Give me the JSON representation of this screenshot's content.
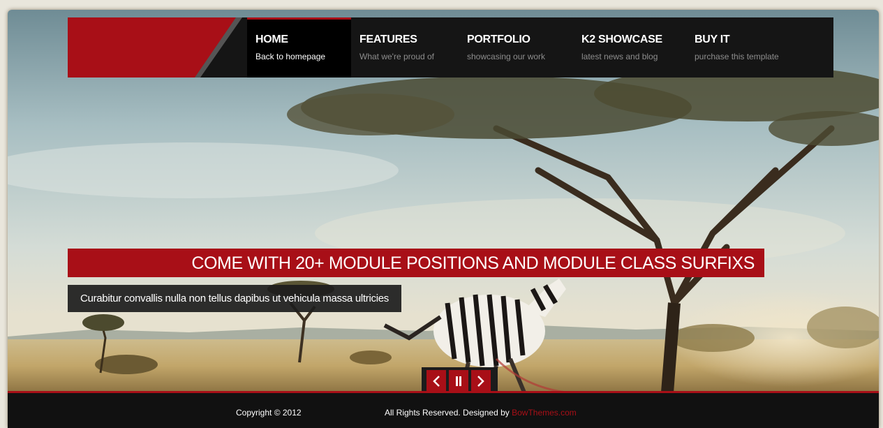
{
  "nav": [
    {
      "title": "HOME",
      "subtitle": "Back to homepage"
    },
    {
      "title": "FEATURES",
      "subtitle": "What we're proud of"
    },
    {
      "title": "PORTFOLIO",
      "subtitle": "showcasing our work"
    },
    {
      "title": "K2 SHOWCASE",
      "subtitle": "latest news and blog"
    },
    {
      "title": "BUY IT",
      "subtitle": "purchase this template"
    }
  ],
  "slide": {
    "title": "COME WITH 20+ MODULE POSITIONS AND MODULE CLASS SURFIXS",
    "text": "Curabitur convallis nulla non tellus dapibus ut vehicula massa ultricies"
  },
  "controls": {
    "prev_icon": "chevron-left-icon",
    "pause_icon": "pause-icon",
    "next_icon": "chevron-right-icon"
  },
  "footer": {
    "copyright": "Copyright © 2012",
    "rights": "All Rights Reserved. Designed by ",
    "designer": "BowThemes.com"
  },
  "colors": {
    "accent": "#a80f17",
    "nav_bg": "#151515",
    "footer_bg": "#111111"
  }
}
